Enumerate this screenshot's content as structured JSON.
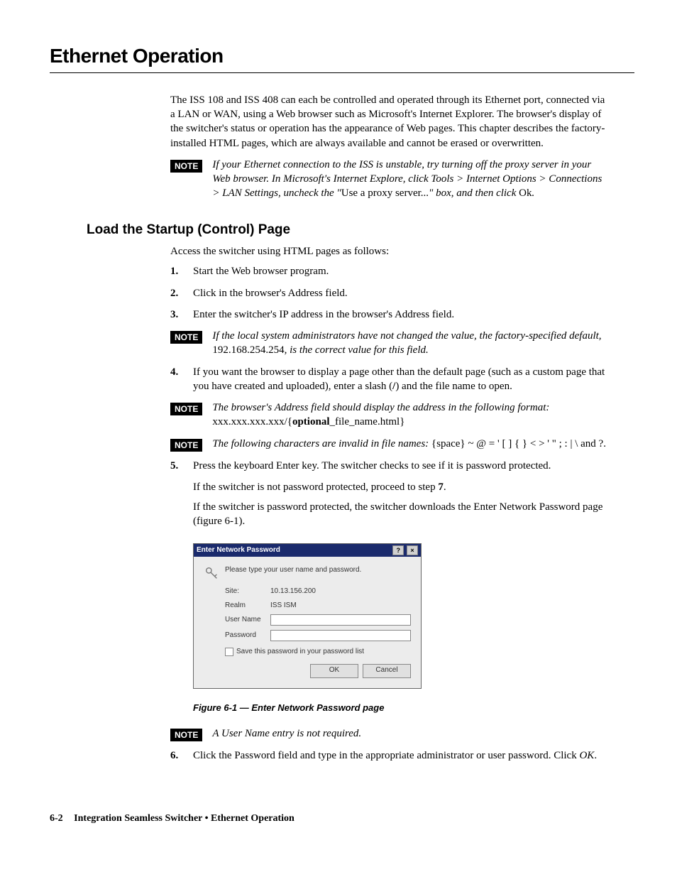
{
  "chapter_title": "Ethernet Operation",
  "intro": "The ISS 108 and ISS 408 can each be controlled and operated through its Ethernet port, connected via a LAN or WAN, using a Web browser such as Microsoft's Internet Explorer.  The browser's display of the switcher's status or operation has the appearance of Web pages.  This chapter describes the factory-installed HTML pages, which are always available and cannot be erased or overwritten.",
  "note_label": "NOTE",
  "note1_a": "If your Ethernet connection to the ISS is unstable, try turning off the proxy server in your Web browser.  In Microsoft's Internet Explore, click Tools > Internet Options > Connections > LAN Settings, uncheck the \"",
  "note1_b": "Use a proxy server...",
  "note1_c": "\" box, and then click ",
  "note1_d": "Ok",
  "note1_e": ".",
  "section_title": "Load the Startup (Control) Page",
  "section_intro": "Access the switcher using HTML pages as follows:",
  "step1_num": "1.",
  "step1_txt": "Start the Web browser program.",
  "step2_num": "2.",
  "step2_txt": "Click in the browser's Address field.",
  "step3_num": "3.",
  "step3_txt": "Enter the switcher's IP address in the browser's Address field.",
  "note2_a": "If the local system administrators have not changed the value, the factory-specified default, ",
  "note2_b": "192.168.254.254",
  "note2_c": ", is the correct value for this field.",
  "step4_num": "4.",
  "step4_txt_a": "If you want the browser to display a page other than the default page (such as a custom page that you have created and uploaded), enter a slash (",
  "step4_txt_b": "/",
  "step4_txt_c": ") and the file name to open.",
  "note3_a": "The browser's Address field should display the address in the following format: ",
  "note3_b": "xxx.xxx.xxx.xxx/{",
  "note3_c": "optional",
  "note3_d": "_file_name.html}",
  "note4_a": "The following characters are invalid in file names: ",
  "note4_b": "{space} ~ @ = ' [ ] { } < > ' \" ; : | \\ ",
  "note4_c": " and ",
  "note4_d": "?.",
  "step5_num": "5.",
  "step5_txt": "Press the keyboard Enter key.  The switcher checks to see if it is password protected.",
  "step5_sub1_a": "If the switcher is not password protected, proceed to step ",
  "step5_sub1_b": "7",
  "step5_sub1_c": ".",
  "step5_sub2": "If the switcher is password protected, the switcher downloads the Enter Network Password page (figure 6-1).",
  "dialog": {
    "title": "Enter Network Password",
    "help": "?",
    "close": "×",
    "msg": "Please type your user name and password.",
    "site_label": "Site:",
    "site_value": "10.13.156.200",
    "realm_label": "Realm",
    "realm_value": "ISS ISM",
    "user_label": "User Name",
    "pass_label": "Password",
    "save_label": "Save this password in your password list",
    "ok": "OK",
    "cancel": "Cancel"
  },
  "figure_caption": "Figure 6-1 — Enter Network Password page",
  "note5": "A User Name entry is not required.",
  "step6_num": "6.",
  "step6_txt_a": "Click the Password field and type in the appropriate administrator or user password.  Click ",
  "step6_txt_b": "OK",
  "step6_txt_c": ".",
  "footer": {
    "page": "6-2",
    "title": "Integration Seamless Switcher • Ethernet Operation"
  }
}
